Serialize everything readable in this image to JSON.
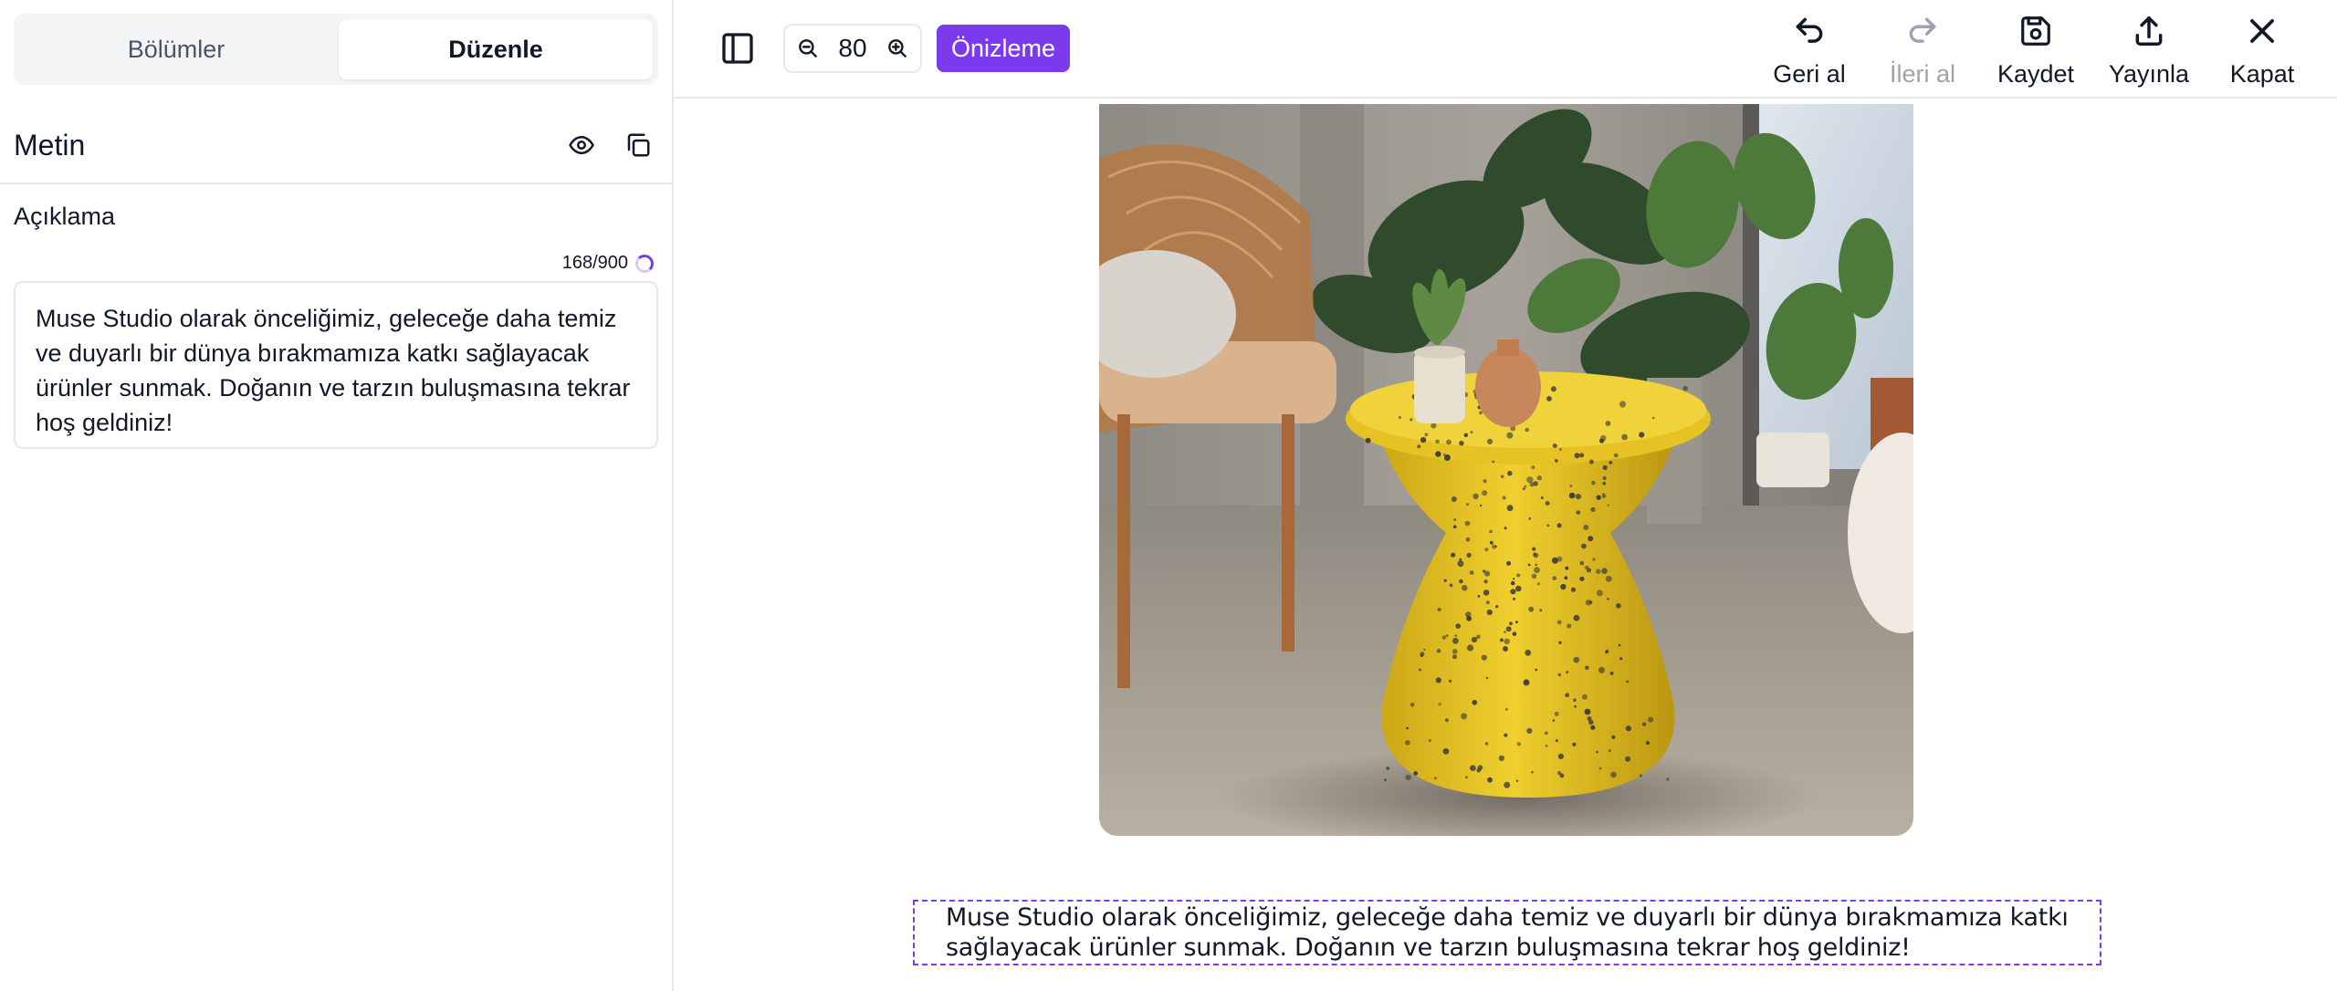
{
  "sidebar": {
    "tabs": [
      {
        "label": "Bölümler",
        "active": false
      },
      {
        "label": "Düzenle",
        "active": true
      }
    ],
    "panel_title": "Metin",
    "field_label": "Açıklama",
    "counter": "168/900",
    "description_value": "Muse Studio olarak önceliğimiz, geleceğe daha temiz ve duyarlı bir dünya bırakmamıza katkı sağlayacak ürünler sunmak. Doğanın ve tarzın buluşmasına tekrar hoş geldiniz!"
  },
  "toolbar": {
    "zoom_value": "80",
    "preview_label": "Önizleme",
    "actions": {
      "undo": "Geri al",
      "redo": "İleri al",
      "save": "Kaydet",
      "publish": "Yayınla",
      "close": "Kapat"
    }
  },
  "canvas": {
    "caption": "Muse Studio olarak önceliğimiz, geleceğe daha temiz ve duyarlı bir dünya bırakmamıza katkı sağlayacak ürünler sunmak. Doğanın ve tarzın buluşmasına tekrar hoş geldiniz!"
  },
  "colors": {
    "accent": "#7c3aed",
    "border": "#e5e7eb",
    "muted_text": "#9ca3af"
  }
}
